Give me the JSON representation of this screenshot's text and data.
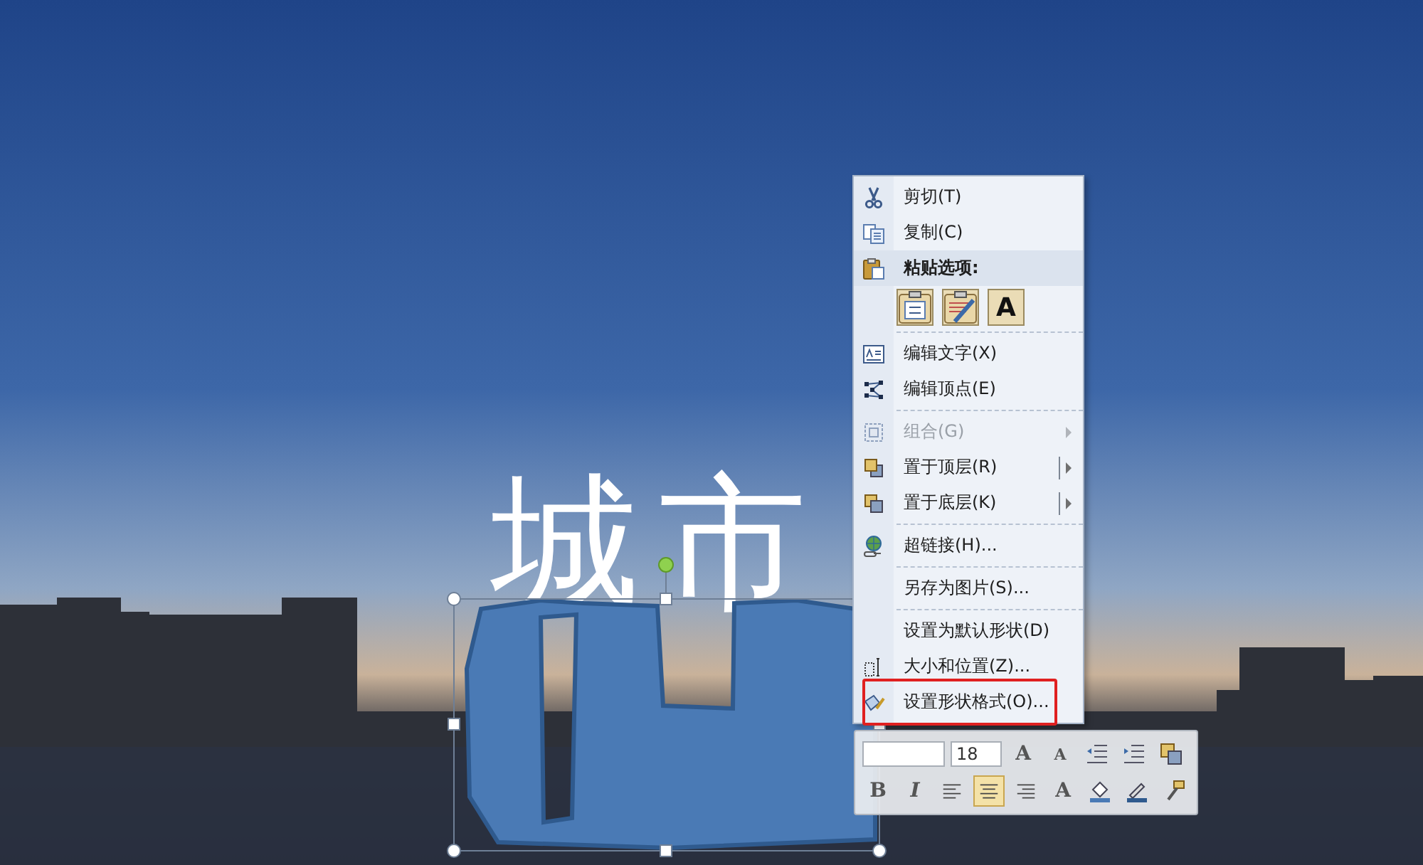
{
  "slide": {
    "title": "城市"
  },
  "context_menu": {
    "items": [
      {
        "kind": "item",
        "label": "剪切(T)",
        "disabled": false
      },
      {
        "kind": "item",
        "label": "复制(C)",
        "disabled": false
      },
      {
        "kind": "header",
        "label": "粘贴选项:"
      },
      {
        "kind": "paste_options",
        "options": [
          {
            "kind": "keep_format"
          },
          {
            "kind": "theme"
          },
          {
            "kind": "text_only",
            "glyph": "A"
          }
        ]
      },
      {
        "kind": "separator"
      },
      {
        "kind": "item",
        "label": "编辑文字(X)",
        "disabled": false
      },
      {
        "kind": "item",
        "label": "编辑顶点(E)",
        "disabled": false
      },
      {
        "kind": "separator"
      },
      {
        "kind": "item",
        "label": "组合(G)",
        "disabled": true,
        "submenu": true,
        "split": false
      },
      {
        "kind": "item",
        "label": "置于顶层(R)",
        "disabled": false,
        "submenu": true,
        "split": true
      },
      {
        "kind": "item",
        "label": "置于底层(K)",
        "disabled": false,
        "submenu": true,
        "split": true
      },
      {
        "kind": "separator"
      },
      {
        "kind": "item",
        "label": "超链接(H)...",
        "disabled": false
      },
      {
        "kind": "separator"
      },
      {
        "kind": "item",
        "label": "另存为图片(S)...",
        "disabled": false
      },
      {
        "kind": "separator"
      },
      {
        "kind": "item",
        "label": "设置为默认形状(D)",
        "disabled": false
      },
      {
        "kind": "item",
        "label": "大小和位置(Z)...",
        "disabled": false
      },
      {
        "kind": "item",
        "label": "设置形状格式(O)...",
        "disabled": false,
        "highlighted": true
      }
    ]
  },
  "mini_toolbar": {
    "rows": [
      [
        {
          "kind": "field"
        },
        {
          "kind": "field",
          "value": "18"
        },
        {
          "kind": "glyph",
          "text": "A"
        },
        {
          "kind": "glyph",
          "text": "A"
        },
        {
          "kind": "icon"
        },
        {
          "kind": "icon"
        },
        {
          "kind": "icon"
        }
      ],
      [
        {
          "kind": "glyph",
          "text": "B",
          "selected": false
        },
        {
          "kind": "glyph",
          "text": "I",
          "selected": false
        },
        {
          "kind": "align",
          "selected": false
        },
        {
          "kind": "align",
          "selected": true
        },
        {
          "kind": "align",
          "selected": false
        },
        {
          "kind": "glyph",
          "text": "A",
          "selected": false
        },
        {
          "kind": "icon"
        },
        {
          "kind": "icon"
        },
        {
          "kind": "icon"
        }
      ]
    ]
  }
}
